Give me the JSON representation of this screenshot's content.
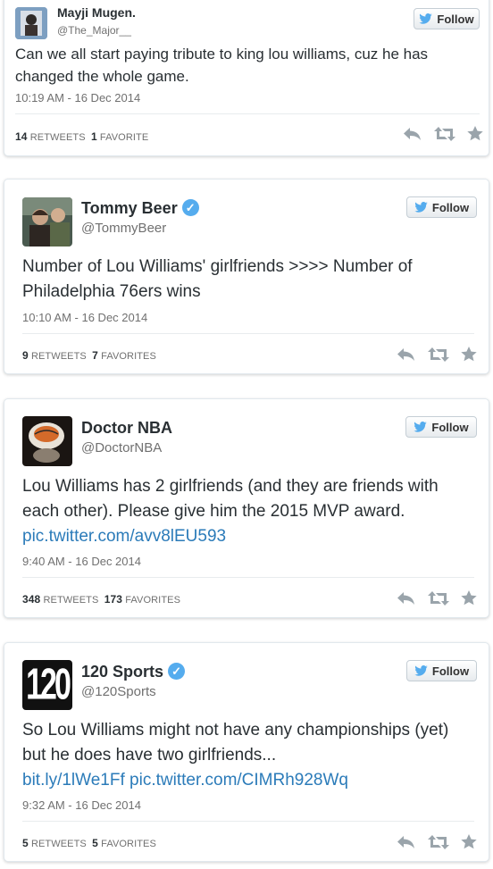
{
  "follow_label": "Follow",
  "tweets": [
    {
      "name": "Mayji Mugen.",
      "handle": "@The_Major__",
      "verified": false,
      "text": "Can we all start paying tribute to king lou williams, cuz he has changed the whole game.",
      "links": [],
      "time": "10:19 AM - 16 Dec 2014",
      "retweets": "14",
      "retweets_label": "RETWEETS",
      "favorites": "1",
      "favorites_label": "FAVORITE"
    },
    {
      "name": "Tommy Beer",
      "handle": "@TommyBeer",
      "verified": true,
      "text": "Number of Lou Williams' girlfriends >>>> Number of Philadelphia 76ers wins",
      "links": [],
      "time": "10:10 AM - 16 Dec 2014",
      "retweets": "9",
      "retweets_label": "RETWEETS",
      "favorites": "7",
      "favorites_label": "FAVORITES"
    },
    {
      "name": "Doctor NBA",
      "handle": "@DoctorNBA",
      "verified": false,
      "text": "Lou Williams has 2 girlfriends (and they are friends with each other). Please give him the 2015 MVP award.",
      "links": [
        "pic.twitter.com/avv8lEU593"
      ],
      "time": "9:40 AM - 16 Dec 2014",
      "retweets": "348",
      "retweets_label": "RETWEETS",
      "favorites": "173",
      "favorites_label": "FAVORITES"
    },
    {
      "name": "120 Sports",
      "handle": "@120Sports",
      "verified": true,
      "avatar_text": "120",
      "text": "So Lou Williams might not have any championships (yet) but he does have two girlfriends...",
      "links": [
        "bit.ly/1lWe1Ff",
        "pic.twitter.com/CIMRh928Wq"
      ],
      "time": "9:32 AM - 16 Dec 2014",
      "retweets": "5",
      "retweets_label": "RETWEETS",
      "favorites": "5",
      "favorites_label": "FAVORITES"
    }
  ],
  "colors": {
    "link": "#2b7bb9",
    "twitter_blue": "#55acee",
    "text": "#292f33",
    "muted": "#707070"
  }
}
